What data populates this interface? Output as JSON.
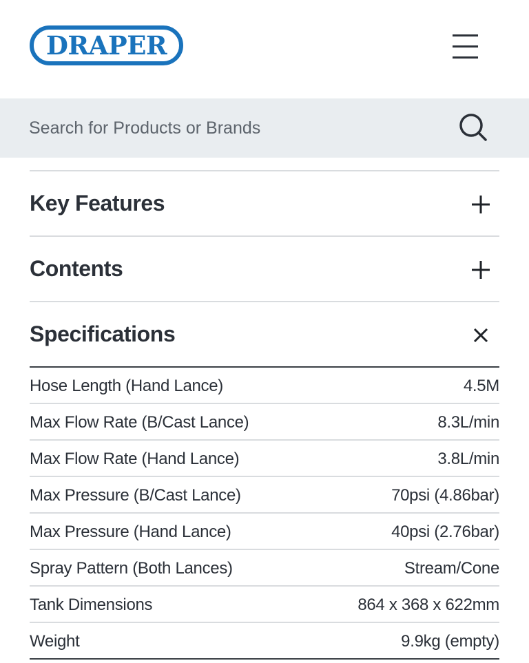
{
  "header": {
    "logo_text": "DRAPER",
    "menu_icon": "hamburger-menu-icon"
  },
  "search": {
    "placeholder": "Search for Products or Brands",
    "value": "",
    "icon": "search-icon"
  },
  "accordion": [
    {
      "title": "Key Features",
      "state": "collapsed",
      "icon": "plus-icon"
    },
    {
      "title": "Contents",
      "state": "collapsed",
      "icon": "plus-icon"
    },
    {
      "title": "Specifications",
      "state": "expanded",
      "icon": "close-icon"
    }
  ],
  "specifications": [
    {
      "label": "Hose Length (Hand Lance)",
      "value": "4.5M"
    },
    {
      "label": "Max Flow Rate (B/Cast Lance)",
      "value": "8.3L/min"
    },
    {
      "label": "Max Flow Rate (Hand Lance)",
      "value": "3.8L/min"
    },
    {
      "label": "Max Pressure (B/Cast Lance)",
      "value": "70psi (4.86bar)"
    },
    {
      "label": "Max Pressure (Hand Lance)",
      "value": "40psi (2.76bar)"
    },
    {
      "label": "Spray Pattern (Both Lances)",
      "value": "Stream/Cone"
    },
    {
      "label": "Tank Dimensions",
      "value": "864 x 368 x 622mm"
    },
    {
      "label": "Weight",
      "value": "9.9kg (empty)"
    }
  ],
  "colors": {
    "brand_blue": "#1a73bc",
    "text": "#2b3038",
    "search_bg": "#e9edf0",
    "divider": "#d9dcdf"
  }
}
